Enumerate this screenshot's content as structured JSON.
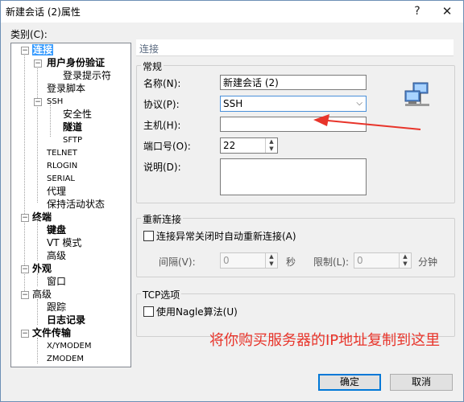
{
  "window": {
    "title": "新建会话 (2)属性",
    "help_glyph": "?",
    "close_glyph": "✕"
  },
  "category_label": "类别(C):",
  "tree": {
    "expand_minus": "−",
    "items": [
      {
        "label": "连接"
      },
      {
        "label": "用户身份验证"
      },
      {
        "label": "登录提示符"
      },
      {
        "label": "登录脚本"
      },
      {
        "label": "SSH"
      },
      {
        "label": "安全性"
      },
      {
        "label": "隧道"
      },
      {
        "label": "SFTP"
      },
      {
        "label": "TELNET"
      },
      {
        "label": "RLOGIN"
      },
      {
        "label": "SERIAL"
      },
      {
        "label": "代理"
      },
      {
        "label": "保持活动状态"
      },
      {
        "label": "终端"
      },
      {
        "label": "键盘"
      },
      {
        "label": "VT 模式"
      },
      {
        "label": "高级"
      },
      {
        "label": "外观"
      },
      {
        "label": "窗口"
      },
      {
        "label": "高级"
      },
      {
        "label": "跟踪"
      },
      {
        "label": "日志记录"
      },
      {
        "label": "文件传输"
      },
      {
        "label": "X/YMODEM"
      },
      {
        "label": "ZMODEM"
      }
    ]
  },
  "panel": {
    "header": "连接",
    "general": {
      "group_label": "常规",
      "name_label": "名称(N):",
      "name_value": "新建会话 (2)",
      "protocol_label": "协议(P):",
      "protocol_value": "SSH",
      "host_label": "主机(H):",
      "host_value": "",
      "port_label": "端口号(O):",
      "port_value": "22",
      "desc_label": "说明(D):",
      "desc_value": ""
    },
    "reconnect": {
      "group_label": "重新连接",
      "checkbox_label": "连接异常关闭时自动重新连接(A)",
      "interval_label": "间隔(V):",
      "interval_value": "0",
      "interval_unit": "秒",
      "limit_label": "限制(L):",
      "limit_value": "0",
      "limit_unit": "分钟"
    },
    "tcp": {
      "group_label": "TCP选项",
      "checkbox_label": "使用Nagle算法(U)"
    }
  },
  "annotation": {
    "text": "将你购买服务器的IP地址复制到这里",
    "color": "#e8342a"
  },
  "buttons": {
    "ok": "确定",
    "cancel": "取消"
  },
  "colors": {
    "selection": "#3399ff",
    "accent": "#0078d7"
  }
}
